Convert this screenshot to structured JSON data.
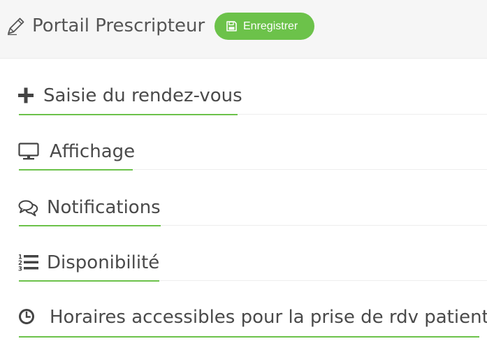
{
  "header": {
    "title": "Portail Prescripteur",
    "save_label": "Enregistrer",
    "icon": "pencil-icon",
    "save_icon": "floppy-disk-icon"
  },
  "sections": [
    {
      "label": "Saisie du rendez-vous",
      "icon": "plus-icon"
    },
    {
      "label": "Affichage",
      "icon": "monitor-icon"
    },
    {
      "label": "Notifications",
      "icon": "chat-bubbles-icon"
    },
    {
      "label": "Disponibilité",
      "icon": "numbered-list-icon"
    },
    {
      "label": "Horaires accessibles pour la prise de rdv patient",
      "icon": "clock-icon"
    }
  ],
  "colors": {
    "accent": "#6cc24a",
    "header_bg": "#f6f6f6",
    "text": "#4a4a4a"
  }
}
